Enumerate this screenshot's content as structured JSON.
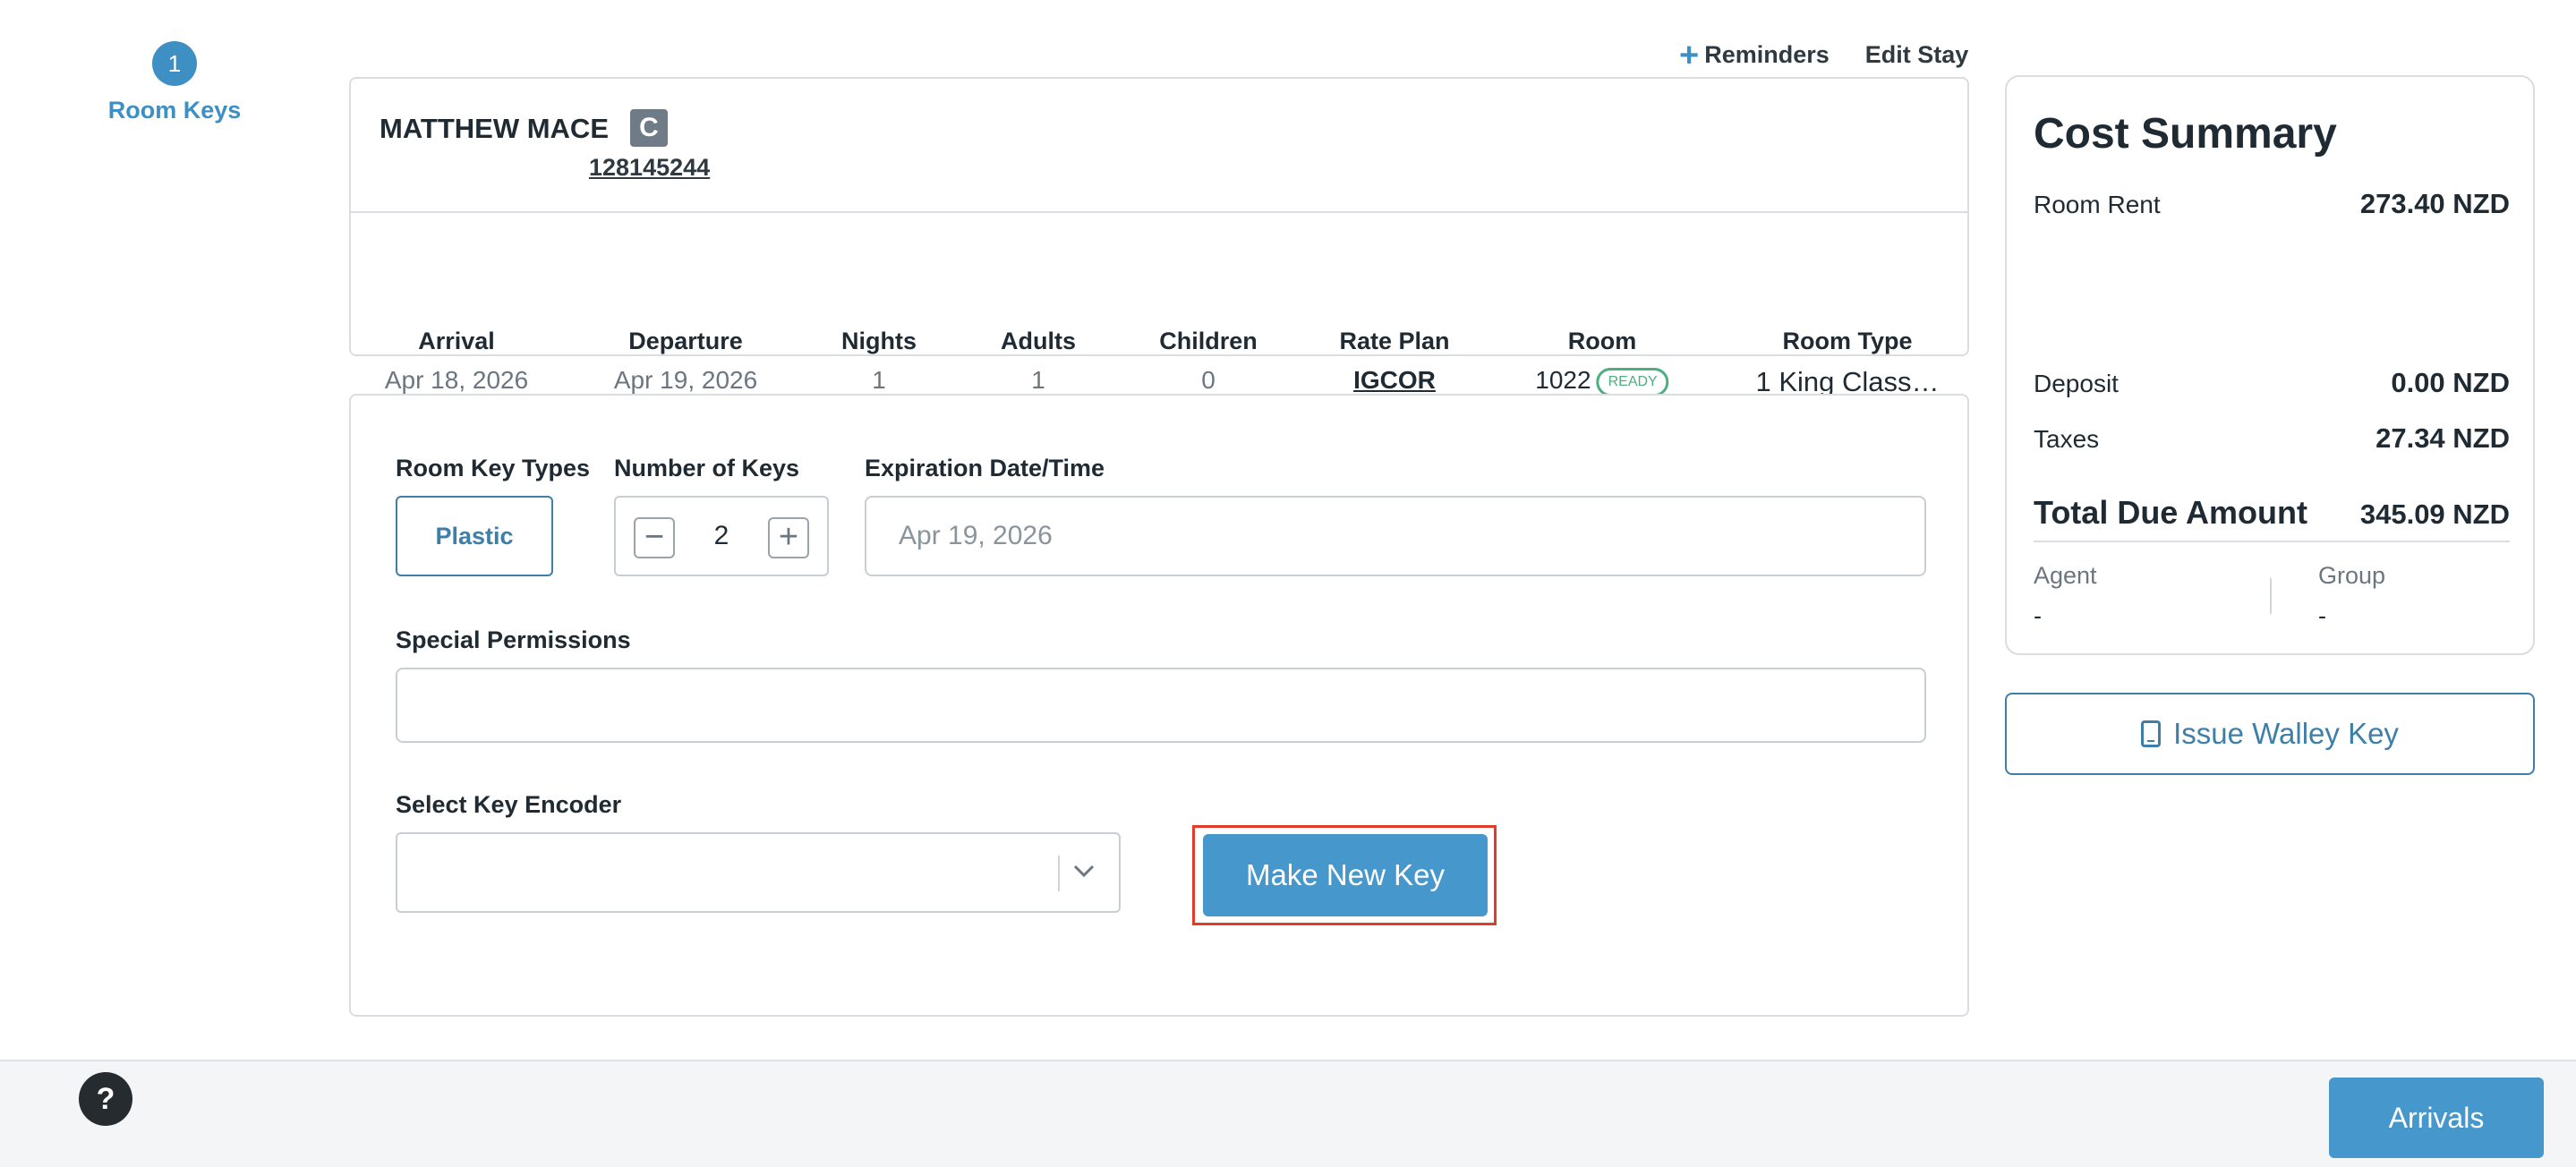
{
  "stepper": {
    "step_number": "1",
    "step_label": "Room Keys"
  },
  "top_links": {
    "reminders": "Reminders",
    "edit_stay": "Edit Stay"
  },
  "guest": {
    "name": "MATTHEW MACE",
    "vip_badge": "C",
    "confirmation": "128145244"
  },
  "stay": {
    "arrival_label": "Arrival",
    "arrival": "Apr 18, 2026",
    "departure_label": "Departure",
    "departure": "Apr 19, 2026",
    "nights_label": "Nights",
    "nights": "1",
    "adults_label": "Adults",
    "adults": "1",
    "children_label": "Children",
    "children": "0",
    "rate_plan_label": "Rate Plan",
    "rate_plan": "IGCOR",
    "room_label": "Room",
    "room": "1022",
    "room_status": "READY",
    "room_type_label": "Room Type",
    "room_type": "1 King Class…"
  },
  "keys": {
    "key_types_label": "Room Key Types",
    "key_type": "Plastic",
    "num_keys_label": "Number of Keys",
    "num_keys": "2",
    "minus_glyph": "−",
    "plus_glyph": "+",
    "expiration_label": "Expiration Date/Time",
    "expiration_value": "Apr 19, 2026",
    "special_permissions_label": "Special Permissions",
    "special_permissions_value": "",
    "encoder_label": "Select Key Encoder",
    "encoder_value": "",
    "make_key_button": "Make New Key"
  },
  "cost": {
    "title": "Cost Summary",
    "room_rent_label": "Room Rent",
    "room_rent": "273.40 NZD",
    "deposit_label": "Deposit",
    "deposit": "0.00 NZD",
    "taxes_label": "Taxes",
    "taxes": "27.34 NZD",
    "total_label": "Total Due Amount",
    "total": "345.09 NZD",
    "agent_label": "Agent",
    "agent": "-",
    "group_label": "Group",
    "group": "-"
  },
  "walley_button": "Issue Walley Key",
  "footer": {
    "help_glyph": "?",
    "arrivals_button": "Arrivals"
  },
  "colors": {
    "accent": "#4697cc",
    "highlight": "#e23b2c",
    "ready": "#4caf7d"
  }
}
